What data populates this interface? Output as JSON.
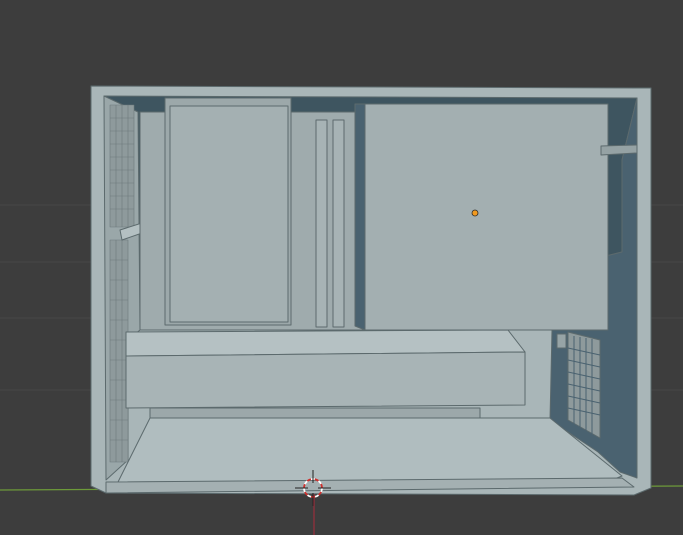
{
  "viewport": {
    "background": "#3d3d3d",
    "grid_color": "#474747",
    "x_axis_color": "#6d9a3a",
    "z_axis_color": "#9a2f3c"
  },
  "scene": {
    "object": "pc-case-model",
    "colors": {
      "panel_light": "#a9b6b8",
      "panel_mid": "#97a4a6",
      "panel_shadow": "#8e9a9c",
      "interior_dark": "#3e5560",
      "interior_blue": "#4a6270",
      "floor": "#b0bdbf",
      "edge": "#5c6a6d",
      "origin_dot": "#f29a1f"
    }
  },
  "cursor_3d": {
    "icon": "3d-cursor-icon",
    "color_a": "#ffffff",
    "color_b": "#d0302d"
  }
}
